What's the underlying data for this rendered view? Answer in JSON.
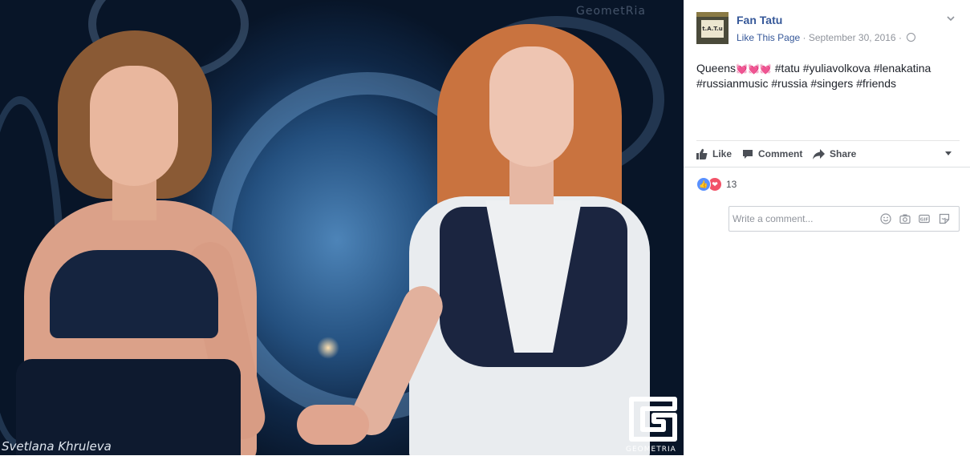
{
  "photo": {
    "watermark": "GeometRia",
    "credit": "Svetlana Khruleva",
    "logo_label": "GEOMETRIA"
  },
  "post": {
    "page_name": "Fan Tatu",
    "like_page": "Like This Page",
    "separator": "·",
    "date": "September 30, 2016",
    "text_line1_prefix": "Queens",
    "text_line1_emoji": "💓💓💓",
    "text_line1_suffix": " #tatu #yuliavolkova #lenakatina",
    "text_line2": "#russianmusic #russia #singers #friends"
  },
  "actions": {
    "like": "Like",
    "comment": "Comment",
    "share": "Share"
  },
  "reactions": {
    "count": "13",
    "icons": [
      "like-reaction-icon",
      "love-reaction-icon"
    ]
  },
  "comment_box": {
    "placeholder": "Write a comment...",
    "icons": [
      "emoji-icon",
      "camera-icon",
      "gif-icon",
      "sticker-icon"
    ]
  },
  "colors": {
    "link": "#365899",
    "muted": "#90949c",
    "like_blue": "#5890ff",
    "love_red": "#f25268"
  }
}
